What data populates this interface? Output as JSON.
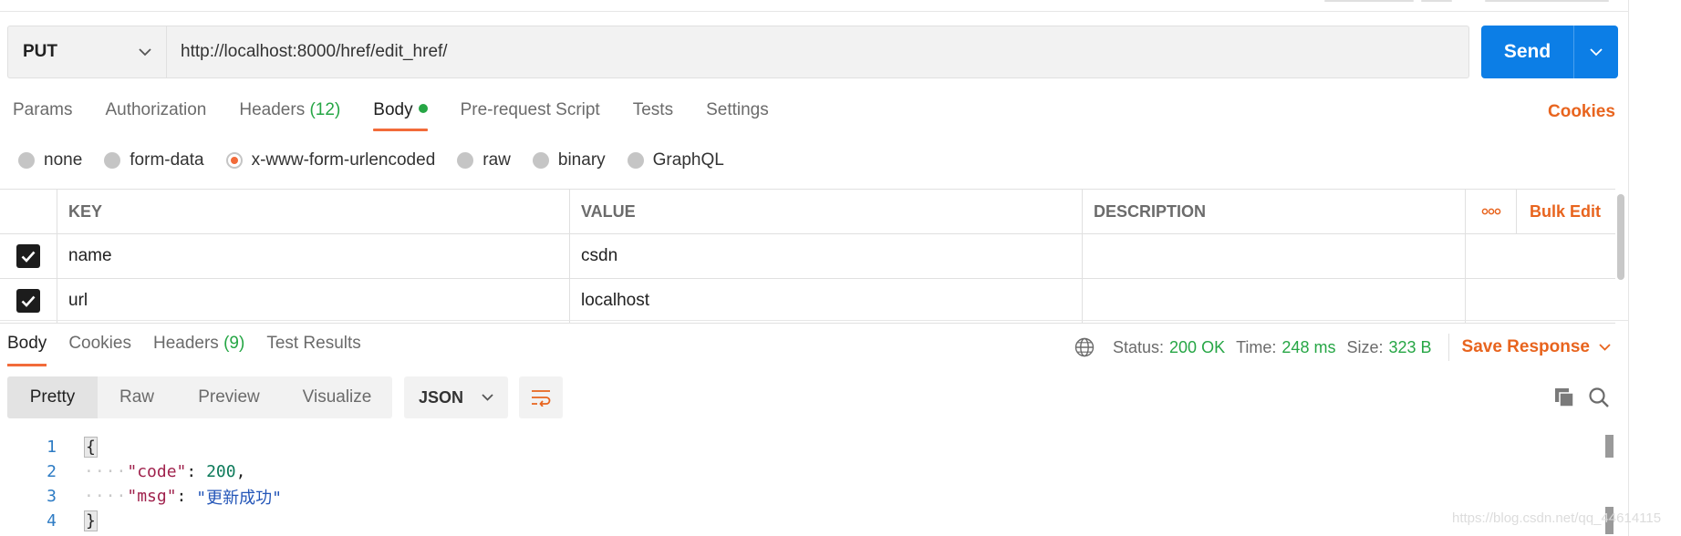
{
  "request": {
    "method": "PUT",
    "url": "http://localhost:8000/href/edit_href/",
    "send_label": "Send"
  },
  "request_tabs": [
    {
      "label": "Params"
    },
    {
      "label": "Authorization"
    },
    {
      "label": "Headers",
      "count": "(12)"
    },
    {
      "label": "Body",
      "active": true
    },
    {
      "label": "Pre-request Script"
    },
    {
      "label": "Tests"
    },
    {
      "label": "Settings"
    }
  ],
  "cookies_label": "Cookies",
  "body_types": [
    {
      "label": "none"
    },
    {
      "label": "form-data"
    },
    {
      "label": "x-www-form-urlencoded",
      "selected": true
    },
    {
      "label": "raw"
    },
    {
      "label": "binary"
    },
    {
      "label": "GraphQL"
    }
  ],
  "params_table": {
    "headers": {
      "key": "KEY",
      "value": "VALUE",
      "description": "DESCRIPTION",
      "bulk_edit": "Bulk Edit"
    },
    "rows": [
      {
        "checked": true,
        "key": "name",
        "value": "csdn",
        "description": ""
      },
      {
        "checked": true,
        "key": "url",
        "value": "localhost",
        "description": ""
      }
    ]
  },
  "response_tabs": [
    {
      "label": "Body",
      "active": true
    },
    {
      "label": "Cookies"
    },
    {
      "label": "Headers",
      "count": "(9)"
    },
    {
      "label": "Test Results"
    }
  ],
  "response_status": {
    "status_label": "Status:",
    "status_value": "200 OK",
    "time_label": "Time:",
    "time_value": "248 ms",
    "size_label": "Size:",
    "size_value": "323 B",
    "save_label": "Save Response"
  },
  "view_modes": [
    {
      "label": "Pretty",
      "active": true
    },
    {
      "label": "Raw"
    },
    {
      "label": "Preview"
    },
    {
      "label": "Visualize"
    }
  ],
  "format_label": "JSON",
  "code_lines": [
    {
      "n": "1",
      "open": "{"
    },
    {
      "n": "2",
      "indent": "····",
      "key": "\"code\"",
      "colon": ": ",
      "value": "200",
      "value_type": "number",
      "trail": ","
    },
    {
      "n": "3",
      "indent": "····",
      "key": "\"msg\"",
      "colon": ": ",
      "value": "\"更新成功\"",
      "value_type": "string",
      "trail": ""
    },
    {
      "n": "4",
      "close": "}"
    }
  ],
  "watermark": "https://blog.csdn.net/qq_44614115",
  "colors": {
    "accent": "#f26b3a",
    "send": "#0c7ee6",
    "success": "#26a645",
    "link": "#e8641e"
  }
}
